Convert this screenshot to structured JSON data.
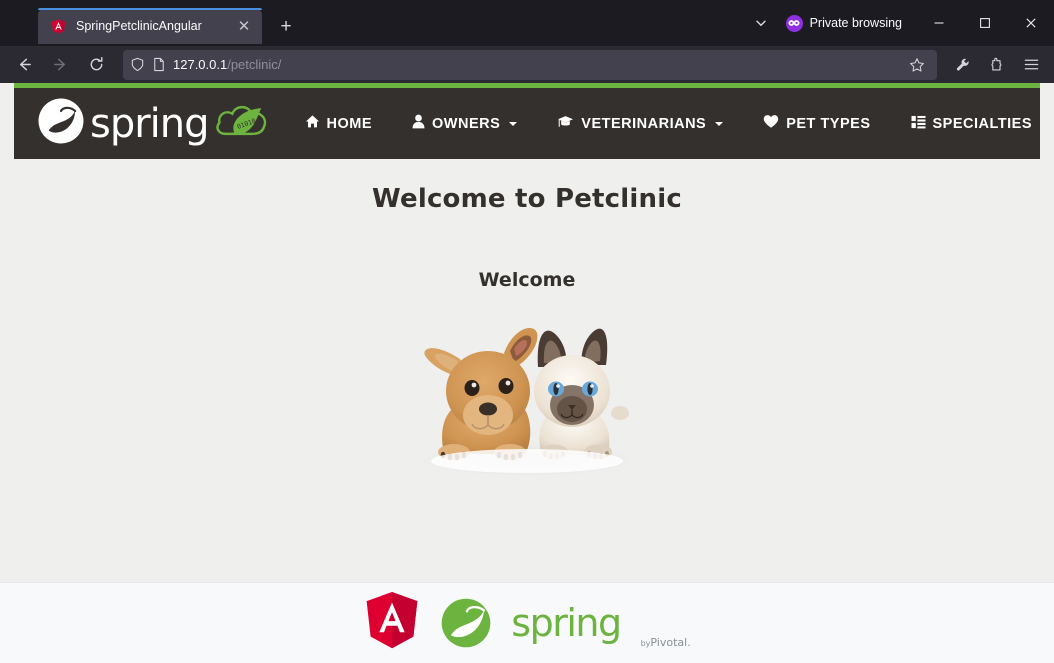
{
  "browser": {
    "tab": {
      "title": "SpringPetclinicAngular",
      "favicon": "angular-shield-icon",
      "close_label": "✕"
    },
    "new_tab_label": "+",
    "list_all_tabs_icon": "chevron-down-icon",
    "private_browsing_label": "Private browsing",
    "window_controls": {
      "minimize": "—",
      "maximize": "□",
      "close": "✕"
    },
    "toolbar": {
      "back_icon": "back-arrow-icon",
      "forward_icon": "forward-arrow-icon",
      "reload_icon": "reload-icon",
      "shield_icon": "shield-icon",
      "page_icon": "page-icon",
      "url_host": "127.0.0.1",
      "url_path": "/petclinic/",
      "url_full": "127.0.0.1/petclinic/",
      "bookmark_icon": "star-icon",
      "devtools_icon": "wrench-icon",
      "extensions_icon": "extensions-icon",
      "menu_icon": "hamburger-menu-icon"
    }
  },
  "page": {
    "brand": {
      "wordmark": "spring",
      "leaf_icon": "spring-leaf-icon",
      "cloud_icon": "spring-cloud-icon",
      "cloud_digits": "01010"
    },
    "nav": [
      {
        "label": "HOME",
        "icon": "home-icon",
        "caret": false
      },
      {
        "label": "OWNERS",
        "icon": "user-icon",
        "caret": true
      },
      {
        "label": "VETERINARIANS",
        "icon": "graduation-cap-icon",
        "caret": true
      },
      {
        "label": "PET TYPES",
        "icon": "heart-icon",
        "caret": false
      },
      {
        "label": "SPECIALTIES",
        "icon": "list-icon",
        "caret": false
      }
    ],
    "heading": "Welcome to Petclinic",
    "subheading": "Welcome",
    "hero_image_alt": "puppy-and-kitten-photo",
    "footer": {
      "angular_logo": "angular-shield-icon",
      "spring_leaf": "spring-leaf-icon",
      "spring_wordmark": "spring",
      "by": "by",
      "pivotal": "Pivotal."
    }
  },
  "colors": {
    "spring_green": "#6db33f",
    "navbar_dark": "#34302d",
    "angular_red": "#dd0031",
    "page_bg": "#efefee",
    "footer_bg": "#f7f9fa"
  }
}
